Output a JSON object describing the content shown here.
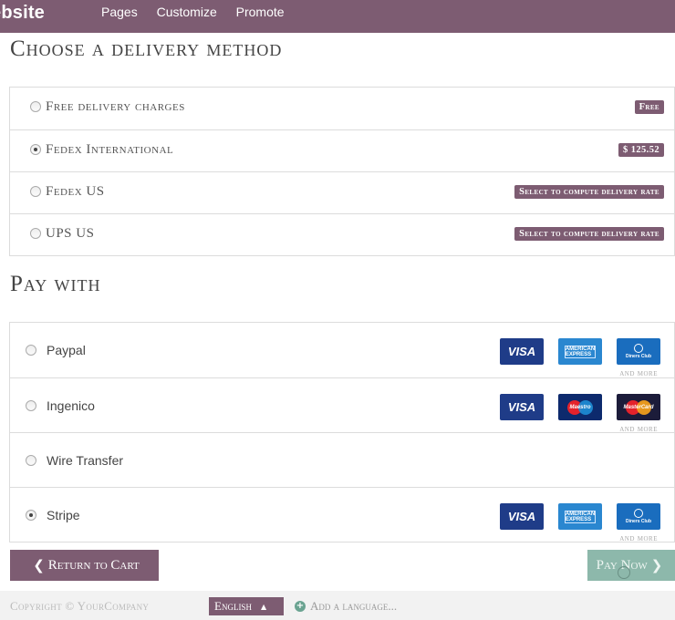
{
  "topbar": {
    "brand": "ebsite",
    "nav": [
      "Pages",
      "Customize",
      "Promote"
    ]
  },
  "delivery": {
    "title": "Choose a delivery method",
    "options": [
      {
        "label": "Free delivery charges",
        "badge": "Free",
        "selected": false
      },
      {
        "label": "Fedex International",
        "badge": "$ 125.52",
        "selected": true
      },
      {
        "label": "Fedex US",
        "badge": "Select to compute delivery rate",
        "selected": false
      },
      {
        "label": "UPS US",
        "badge": "Select to compute delivery rate",
        "selected": false
      }
    ]
  },
  "payment": {
    "title": "Pay with",
    "methods": [
      {
        "label": "Paypal",
        "selected": false,
        "cards": [
          "visa",
          "american-express",
          "diners-club"
        ],
        "more": "and more"
      },
      {
        "label": "Ingenico",
        "selected": false,
        "cards": [
          "visa",
          "maestro",
          "mastercard"
        ],
        "more": "and more"
      },
      {
        "label": "Wire Transfer",
        "selected": false,
        "cards": []
      },
      {
        "label": "Stripe",
        "selected": true,
        "cards": [
          "visa",
          "american-express",
          "diners-club"
        ],
        "more": "and more"
      }
    ],
    "card_text": {
      "visa": "VISA",
      "amex": "AMERICAN EXPRESS",
      "diners": "Diners Club",
      "maestro": "Maestro",
      "mastercard": "MasterCard"
    }
  },
  "buttons": {
    "return_label": "Return to Cart",
    "pay_label": "Pay Now"
  },
  "footer": {
    "copyright": "Copyright © YourCompany",
    "language": "English",
    "add_language": "Add a language..."
  },
  "colors": {
    "brand": "#7d5c72",
    "pay_button": "#8db8ab",
    "visa": "#1f3c88",
    "amex": "#2a87d0"
  }
}
